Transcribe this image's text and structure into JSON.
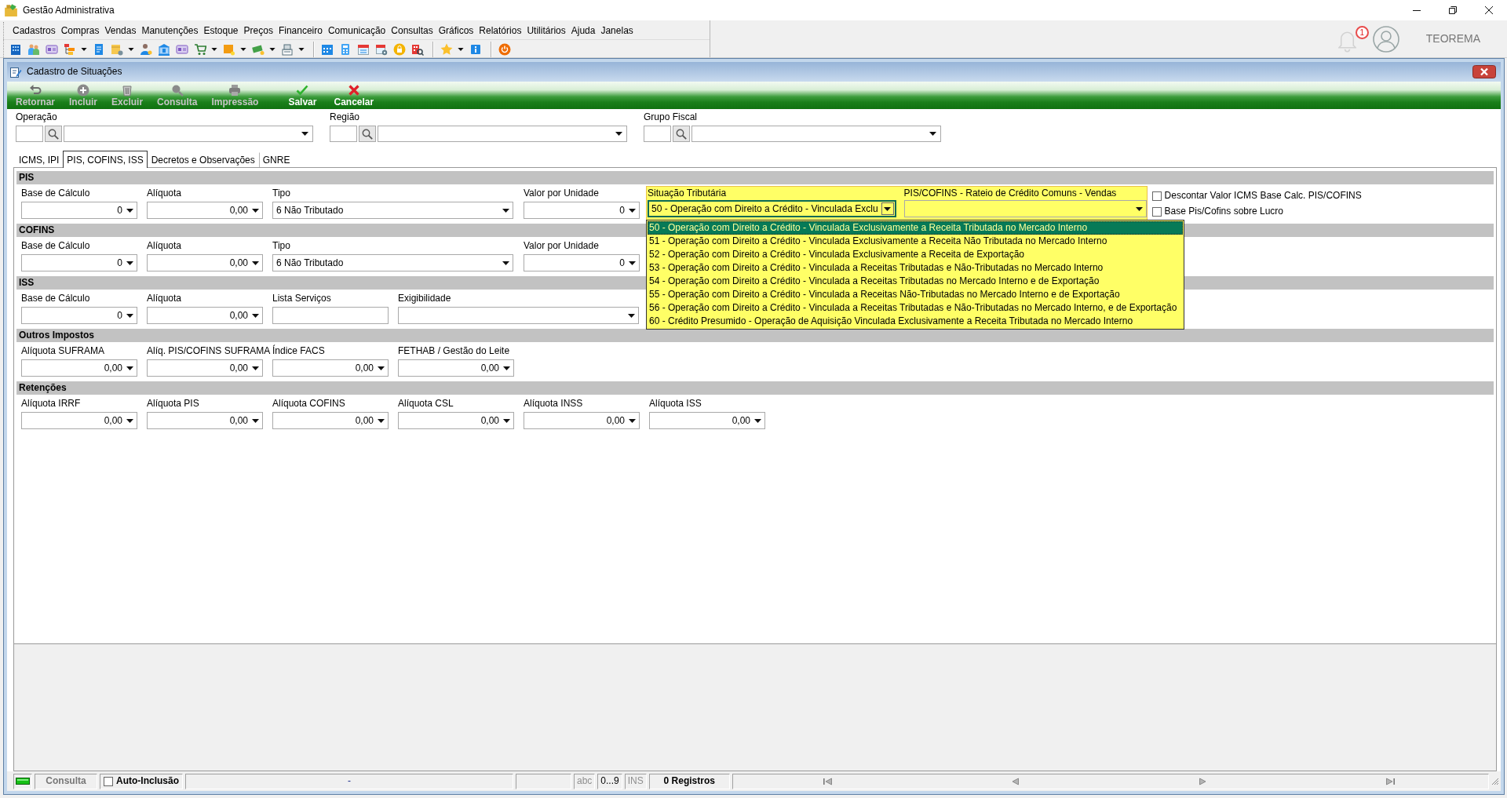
{
  "window": {
    "title": "Gestão Administrativa"
  },
  "menu": [
    "Cadastros",
    "Compras",
    "Vendas",
    "Manutenções",
    "Estoque",
    "Preços",
    "Financeiro",
    "Comunicação",
    "Consultas",
    "Gráficos",
    "Relatórios",
    "Utilitários",
    "Ajuda",
    "Janelas"
  ],
  "notifications": {
    "count": "1"
  },
  "user": {
    "name": "TEOREMA"
  },
  "form": {
    "title": "Cadastro de Situações",
    "actions": [
      {
        "label": "Retornar",
        "disabled": true
      },
      {
        "label": "Incluir",
        "disabled": true
      },
      {
        "label": "Excluir",
        "disabled": true
      },
      {
        "label": "Consulta",
        "disabled": true
      },
      {
        "label": "Impressão",
        "disabled": true
      },
      {
        "label": "Salvar",
        "disabled": false
      },
      {
        "label": "Cancelar",
        "disabled": false
      }
    ],
    "lookups": [
      {
        "label": "Operação"
      },
      {
        "label": "Região"
      },
      {
        "label": "Grupo Fiscal"
      }
    ],
    "tabs": [
      {
        "label": "ICMS, IPI",
        "selected": false
      },
      {
        "label": "PIS, COFINS, ISS",
        "selected": true
      },
      {
        "label": "Decretos e Observações",
        "selected": false
      },
      {
        "label": "GNRE",
        "selected": false
      }
    ],
    "sections": [
      {
        "title": "PIS",
        "fields": [
          {
            "label": "Base de Cálculo",
            "kind": "spin",
            "value": "0"
          },
          {
            "label": "Alíquota",
            "kind": "spin",
            "value": "0,00"
          },
          {
            "label": "Tipo",
            "kind": "combo",
            "value": "6 Não Tributado"
          },
          {
            "label": "Valor por Unidade",
            "kind": "spin",
            "value": "0"
          }
        ],
        "tax_situation": {
          "label": "Situação Tributária",
          "value": "50 - Operação com Direito a Crédito - Vinculada Exclu",
          "expanded": true,
          "options": [
            {
              "label": "50 - Operação com Direito a Crédito - Vinculada Exclusivamente a Receita Tributada no Mercado Interno",
              "selected": true
            },
            {
              "label": "51 - Operação com Direito a Crédito - Vinculada Exclusivamente a Receita Não Tributada no Mercado Interno",
              "selected": false
            },
            {
              "label": "52 - Operação com Direito a Crédito - Vinculada Exclusivamente a Receita de Exportação",
              "selected": false
            },
            {
              "label": "53 - Operação com Direito a Crédito - Vinculada a Receitas Tributadas e Não-Tributadas no Mercado Interno",
              "selected": false
            },
            {
              "label": "54 - Operação com Direito a Crédito - Vinculada a Receitas Tributadas no Mercado Interno e de Exportação",
              "selected": false
            },
            {
              "label": "55 - Operação com Direito a Crédito - Vinculada a Receitas Não-Tributadas no Mercado Interno e de Exportação",
              "selected": false
            },
            {
              "label": "56 - Operação com Direito a Crédito - Vinculada a Receitas Tributadas e Não-Tributadas no Mercado Interno, e de Exportação",
              "selected": false
            },
            {
              "label": "60 - Crédito Presumido - Operação de Aquisição Vinculada Exclusivamente a Receita Tributada no Mercado Interno",
              "selected": false
            }
          ]
        },
        "credit_apportionment": {
          "label": "PIS/COFINS - Rateio de Crédito Comuns - Vendas"
        },
        "checkboxes": [
          {
            "label": "Descontar Valor ICMS Base Calc. PIS/COFINS",
            "checked": false
          },
          {
            "label": "Base Pis/Cofins sobre Lucro",
            "checked": false
          }
        ]
      },
      {
        "title": "COFINS",
        "fields": [
          {
            "label": "Base de Cálculo",
            "kind": "spin",
            "value": "0"
          },
          {
            "label": "Alíquota",
            "kind": "spin",
            "value": "0,00"
          },
          {
            "label": "Tipo",
            "kind": "combo",
            "value": "6 Não Tributado"
          },
          {
            "label": "Valor por Unidade",
            "kind": "spin",
            "value": "0"
          }
        ]
      },
      {
        "title": "ISS",
        "fields": [
          {
            "label": "Base de Cálculo",
            "kind": "spin",
            "value": "0"
          },
          {
            "label": "Alíquota",
            "kind": "spin",
            "value": "0,00"
          },
          {
            "label": "Lista Serviços",
            "kind": "text"
          },
          {
            "label": "Exigibilidade",
            "kind": "combo"
          }
        ]
      },
      {
        "title": "Outros Impostos",
        "fields": [
          {
            "label": "Alíquota SUFRAMA",
            "kind": "spin",
            "value": "0,00"
          },
          {
            "label": "Alíq. PIS/COFINS SUFRAMA",
            "kind": "spin",
            "value": "0,00"
          },
          {
            "label": "Índice FACS",
            "kind": "spin",
            "value": "0,00"
          },
          {
            "label": "FETHAB / Gestão do Leite",
            "kind": "spin",
            "value": "0,00"
          }
        ]
      },
      {
        "title": "Retenções",
        "fields": [
          {
            "label": "Alíquota IRRF",
            "kind": "spin",
            "value": "0,00"
          },
          {
            "label": "Alíquota PIS",
            "kind": "spin",
            "value": "0,00"
          },
          {
            "label": "Alíquota COFINS",
            "kind": "spin",
            "value": "0,00"
          },
          {
            "label": "Alíquota CSL",
            "kind": "spin",
            "value": "0,00"
          },
          {
            "label": "Alíquota INSS",
            "kind": "spin",
            "value": "0,00"
          },
          {
            "label": "Alíquota ISS",
            "kind": "spin",
            "value": "0,00"
          }
        ]
      }
    ]
  },
  "status_bar": {
    "mode": "Consulta",
    "auto_inclusion": {
      "label": "Auto-Inclusão",
      "checked": false
    },
    "message": "-",
    "indicators": [
      {
        "label": "abc",
        "on": false
      },
      {
        "label": "0...9",
        "on": true
      },
      {
        "label": "INS",
        "on": false
      }
    ],
    "records": "0 Registros"
  }
}
